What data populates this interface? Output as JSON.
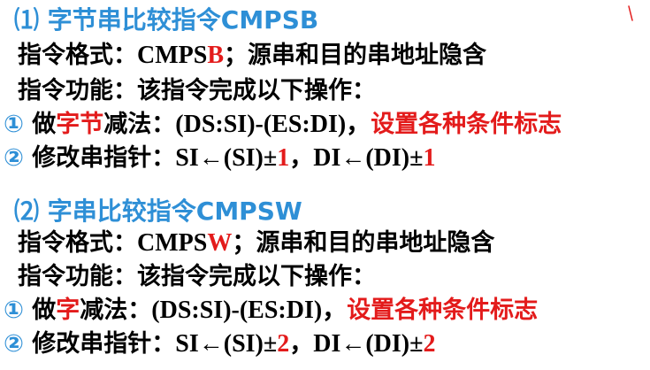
{
  "colors": {
    "heading": "#2e8fd6",
    "accent": "#e31b1b",
    "text": "#000000"
  },
  "sections": [
    {
      "title_num": "⑴",
      "title_text": " 字节串比较指令CMPSB",
      "format_label": "指令格式：",
      "format_op_prefix": "CMPS",
      "format_op_suffix": "B",
      "format_note": "；源串和目的串地址隐含",
      "function_label": "指令功能：该指令完成以下操作：",
      "op1_num": "①",
      "op1_pre": " 做",
      "op1_highlight": "字节",
      "op1_mid": "减法：",
      "op1_expr": "(DS:SI)-(ES:DI)，",
      "op1_flags": "设置各种条件标志",
      "op2_num": "②",
      "op2_label": " 修改串指针：",
      "op2_si": "SI←(SI)±",
      "op2_si_val": "1",
      "op2_sep": "，",
      "op2_di": "DI←(DI)±",
      "op2_di_val": "1"
    },
    {
      "title_num": "⑵",
      "title_text": " 字串比较指令CMPSW",
      "format_label": "指令格式：",
      "format_op_prefix": "CMPS",
      "format_op_suffix": "W",
      "format_note": "；源串和目的串地址隐含",
      "function_label": "指令功能：该指令完成以下操作：",
      "op1_num": "①",
      "op1_pre": " 做",
      "op1_highlight": "字",
      "op1_mid": "减法：",
      "op1_expr": "(DS:SI)-(ES:DI)，",
      "op1_flags": "设置各种条件标志",
      "op2_num": "②",
      "op2_label": " 修改串指针：",
      "op2_si": "SI←(SI)±",
      "op2_si_val": "2",
      "op2_sep": "，",
      "op2_di": "DI←(DI)±",
      "op2_di_val": "2"
    }
  ]
}
